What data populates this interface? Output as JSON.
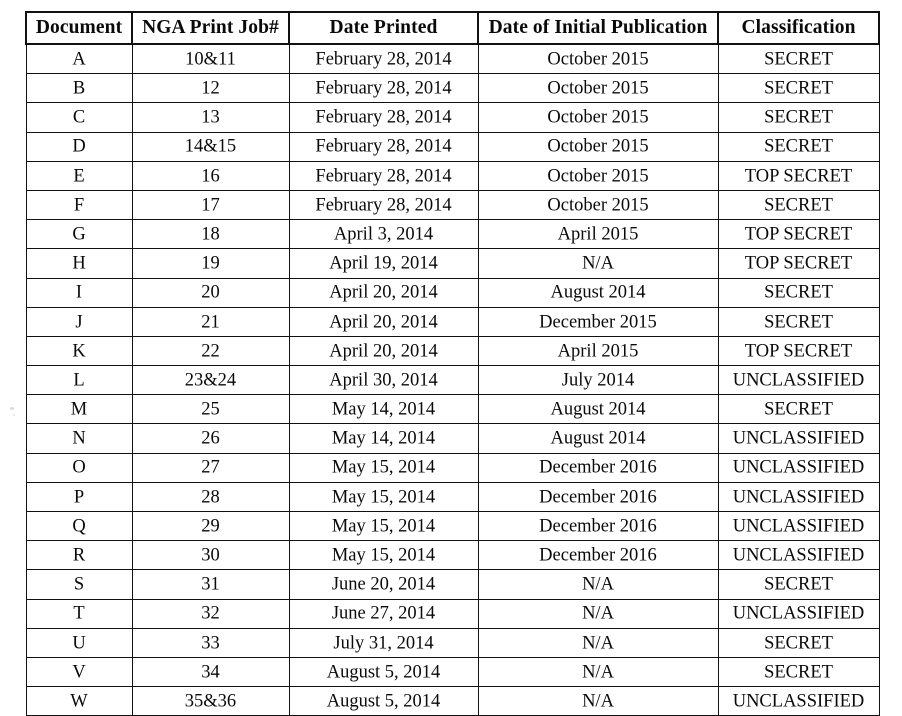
{
  "table": {
    "columns": [
      "Document",
      "NGA Print Job#",
      "Date Printed",
      "Date of Initial Publication",
      "Classification"
    ],
    "rows": [
      {
        "document": "A",
        "job": "10&11",
        "date_printed": "February 28, 2014",
        "date_published": "October 2015",
        "classification": "SECRET"
      },
      {
        "document": "B",
        "job": "12",
        "date_printed": "February 28, 2014",
        "date_published": "October 2015",
        "classification": "SECRET"
      },
      {
        "document": "C",
        "job": "13",
        "date_printed": "February 28, 2014",
        "date_published": "October 2015",
        "classification": "SECRET"
      },
      {
        "document": "D",
        "job": "14&15",
        "date_printed": "February 28, 2014",
        "date_published": "October 2015",
        "classification": "SECRET"
      },
      {
        "document": "E",
        "job": "16",
        "date_printed": "February 28, 2014",
        "date_published": "October 2015",
        "classification": "TOP SECRET"
      },
      {
        "document": "F",
        "job": "17",
        "date_printed": "February 28, 2014",
        "date_published": "October 2015",
        "classification": "SECRET"
      },
      {
        "document": "G",
        "job": "18",
        "date_printed": "April 3, 2014",
        "date_published": "April 2015",
        "classification": "TOP SECRET"
      },
      {
        "document": "H",
        "job": "19",
        "date_printed": "April 19, 2014",
        "date_published": "N/A",
        "classification": "TOP SECRET"
      },
      {
        "document": "I",
        "job": "20",
        "date_printed": "April 20, 2014",
        "date_published": "August 2014",
        "classification": "SECRET"
      },
      {
        "document": "J",
        "job": "21",
        "date_printed": "April 20, 2014",
        "date_published": "December 2015",
        "classification": "SECRET"
      },
      {
        "document": "K",
        "job": "22",
        "date_printed": "April 20, 2014",
        "date_published": "April 2015",
        "classification": "TOP SECRET"
      },
      {
        "document": "L",
        "job": "23&24",
        "date_printed": "April 30, 2014",
        "date_published": "July 2014",
        "classification": "UNCLASSIFIED"
      },
      {
        "document": "M",
        "job": "25",
        "date_printed": "May 14, 2014",
        "date_published": "August 2014",
        "classification": "SECRET"
      },
      {
        "document": "N",
        "job": "26",
        "date_printed": "May 14, 2014",
        "date_published": "August 2014",
        "classification": "UNCLASSIFIED"
      },
      {
        "document": "O",
        "job": "27",
        "date_printed": "May 15, 2014",
        "date_published": "December 2016",
        "classification": "UNCLASSIFIED"
      },
      {
        "document": "P",
        "job": "28",
        "date_printed": "May 15, 2014",
        "date_published": "December 2016",
        "classification": "UNCLASSIFIED"
      },
      {
        "document": "Q",
        "job": "29",
        "date_printed": "May 15, 2014",
        "date_published": "December 2016",
        "classification": "UNCLASSIFIED"
      },
      {
        "document": "R",
        "job": "30",
        "date_printed": "May 15, 2014",
        "date_published": "December 2016",
        "classification": "UNCLASSIFIED"
      },
      {
        "document": "S",
        "job": "31",
        "date_printed": "June 20, 2014",
        "date_published": "N/A",
        "classification": "SECRET"
      },
      {
        "document": "T",
        "job": "32",
        "date_printed": "June 27, 2014",
        "date_published": "N/A",
        "classification": "UNCLASSIFIED"
      },
      {
        "document": "U",
        "job": "33",
        "date_printed": "July 31, 2014",
        "date_published": "N/A",
        "classification": "SECRET"
      },
      {
        "document": "V",
        "job": "34",
        "date_printed": "August 5, 2014",
        "date_published": "N/A",
        "classification": "SECRET"
      },
      {
        "document": "W",
        "job": "35&36",
        "date_printed": "August 5, 2014",
        "date_published": "N/A",
        "classification": "UNCLASSIFIED"
      }
    ]
  }
}
